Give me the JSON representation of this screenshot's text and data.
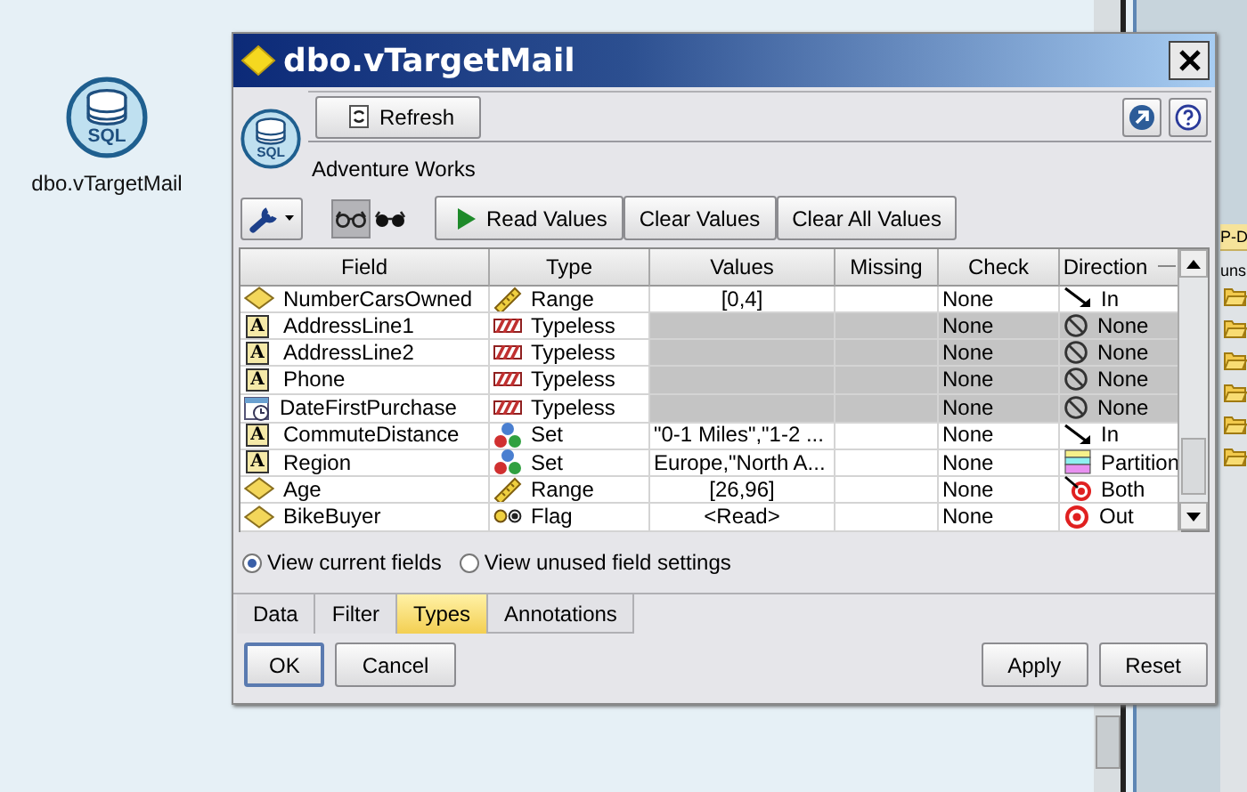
{
  "desktop_node": {
    "icon_label": "SQL",
    "label": "dbo.vTargetMail"
  },
  "side_panel": {
    "header": "P-D",
    "text": "uns"
  },
  "dialog": {
    "title": "dbo.vTargetMail",
    "icon_label": "SQL",
    "refresh_button": "Refresh",
    "source": "Adventure Works",
    "view_toggles": [
      {
        "selected": true
      },
      {
        "selected": false
      }
    ],
    "actions": [
      "Read Values",
      "Clear Values",
      "Clear All Values"
    ],
    "table": {
      "columns": [
        "Field",
        "Type",
        "Values",
        "Missing",
        "Check",
        "Direction"
      ],
      "rows": [
        {
          "field": {
            "text": "NumberCarsOwned",
            "kind": "continuous"
          },
          "type": {
            "text": "Range",
            "kind": "range"
          },
          "values": "[0,4]",
          "check": "None",
          "direction": {
            "text": "In",
            "kind": "in"
          },
          "disabled": false
        },
        {
          "field": {
            "text": "AddressLine1",
            "kind": "string",
            "icon": "A"
          },
          "type": {
            "text": "Typeless",
            "kind": "typeless"
          },
          "check": "None",
          "direction": {
            "text": "None",
            "kind": "none"
          },
          "disabled": true
        },
        {
          "field": {
            "text": "AddressLine2",
            "kind": "string",
            "icon": "A"
          },
          "type": {
            "text": "Typeless",
            "kind": "typeless"
          },
          "check": "None",
          "direction": {
            "text": "None",
            "kind": "none"
          },
          "disabled": true
        },
        {
          "field": {
            "text": "Phone",
            "kind": "string",
            "icon": "A"
          },
          "type": {
            "text": "Typeless",
            "kind": "typeless"
          },
          "check": "None",
          "direction": {
            "text": "None",
            "kind": "none"
          },
          "disabled": true
        },
        {
          "field": {
            "text": "DateFirstPurchase",
            "kind": "date"
          },
          "type": {
            "text": "Typeless",
            "kind": "typeless"
          },
          "check": "None",
          "direction": {
            "text": "None",
            "kind": "none"
          },
          "disabled": true
        },
        {
          "field": {
            "text": "CommuteDistance",
            "kind": "string",
            "icon": "A"
          },
          "type": {
            "text": "Set",
            "kind": "set"
          },
          "values": "\"0-1 Miles\",\"1-2 ...",
          "check": "None",
          "direction": {
            "text": "In",
            "kind": "in"
          },
          "disabled": false
        },
        {
          "field": {
            "text": "Region",
            "kind": "string",
            "icon": "A"
          },
          "type": {
            "text": "Set",
            "kind": "set"
          },
          "values": "Europe,\"North A...",
          "check": "None",
          "direction": {
            "text": "Partition",
            "kind": "partition"
          },
          "disabled": false
        },
        {
          "field": {
            "text": "Age",
            "kind": "continuous"
          },
          "type": {
            "text": "Range",
            "kind": "range"
          },
          "values": "[26,96]",
          "check": "None",
          "direction": {
            "text": "Both",
            "kind": "both"
          },
          "disabled": false
        },
        {
          "field": {
            "text": "BikeBuyer",
            "kind": "continuous"
          },
          "type": {
            "text": "Flag",
            "kind": "flag"
          },
          "values": "<Read>",
          "check": "None",
          "direction": {
            "text": "Out",
            "kind": "out"
          },
          "disabled": false
        }
      ]
    },
    "view_options": [
      {
        "label": "View current fields",
        "selected": true
      },
      {
        "label": "View unused field settings",
        "selected": false
      }
    ],
    "tabs": [
      {
        "label": "Data",
        "selected": false
      },
      {
        "label": "Filter",
        "selected": false
      },
      {
        "label": "Types",
        "selected": true
      },
      {
        "label": "Annotations",
        "selected": false
      }
    ],
    "buttons": [
      {
        "label": "OK",
        "kind": "default"
      },
      {
        "label": "Cancel",
        "kind": "normal"
      },
      {
        "label": "Apply",
        "kind": "normal"
      },
      {
        "label": "Reset",
        "kind": "normal"
      }
    ]
  }
}
